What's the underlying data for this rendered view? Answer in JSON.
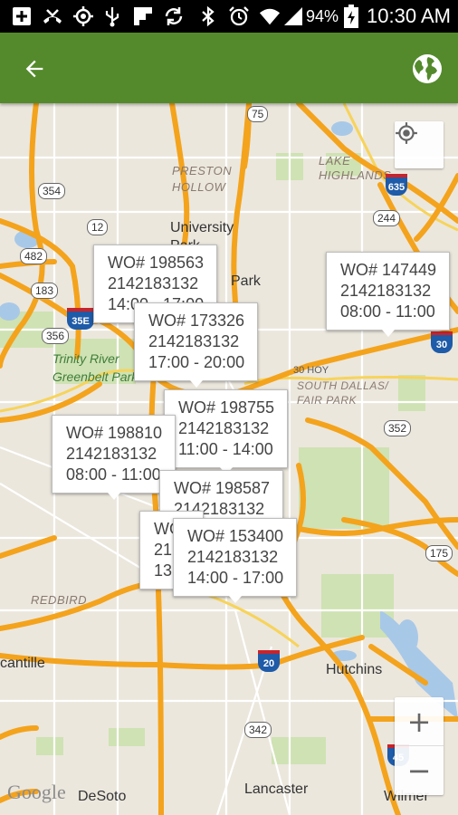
{
  "status_bar": {
    "icons": [
      "add-box-icon",
      "missed-call-icon",
      "gps-icon",
      "usb-icon",
      "flipboard-icon",
      "sync-icon",
      "bluetooth-icon",
      "alarm-icon",
      "wifi-icon",
      "signal-icon",
      "battery-charging-icon"
    ],
    "battery": "94%",
    "time": "10:30 AM"
  },
  "app_bar": {
    "back_icon": "arrow-back-icon",
    "globe_icon": "globe-icon",
    "colors": {
      "bar": "#548a2c"
    }
  },
  "map": {
    "labels": {
      "preston_hollow": "PRESTON\nHOLLOW",
      "university_park": "University\nPark",
      "park": "Park",
      "lake_highlands": "LAKE\nHIGHLANDS",
      "trinity_river": "Trinity River\nGreenbelt Park",
      "redbird": "REDBIRD",
      "south_dallas": "SOUTH DALLAS/\nFAIR PARK",
      "hutchins": "Hutchins",
      "lancaster": "Lancaster",
      "desoto": "DeSoto",
      "wilmer": "Wilmer",
      "cedar_hill": "cantille",
      "route_30": "30 HOY"
    },
    "shields": {
      "s75": "75",
      "s354": "354",
      "s12": "12",
      "s482": "482",
      "s183": "183",
      "s356": "356",
      "s244": "244",
      "s352": "352",
      "s175": "175",
      "s342": "342"
    },
    "interstates": {
      "i635": "635",
      "i35e": "35E",
      "i30": "30",
      "i20": "20",
      "i45": "45"
    },
    "google": "Google"
  },
  "markers": [
    {
      "wo": "WO# 198563",
      "phone": "2142183132",
      "time": "14:00 - 17:00"
    },
    {
      "wo": "WO# 147449",
      "phone": "2142183132",
      "time": "08:00 - 11:00"
    },
    {
      "wo": "WO# 173326",
      "phone": "2142183132",
      "time": "17:00 - 20:00"
    },
    {
      "wo": "WO# 198755",
      "phone": "2142183132",
      "time": "11:00 - 14:00"
    },
    {
      "wo": "WO# 198810",
      "phone": "2142183132",
      "time": "08:00 - 11:00"
    },
    {
      "wo": "WO# 198587",
      "phone": "2142183132",
      "time": ""
    },
    {
      "wo": "WO",
      "phone": "21",
      "time": "13"
    },
    {
      "wo": "WO# 153400",
      "phone": "2142183132",
      "time": "14:00 - 17:00"
    }
  ],
  "controls": {
    "locate_icon": "my-location-icon",
    "zoom_in": "+",
    "zoom_out": "−"
  }
}
